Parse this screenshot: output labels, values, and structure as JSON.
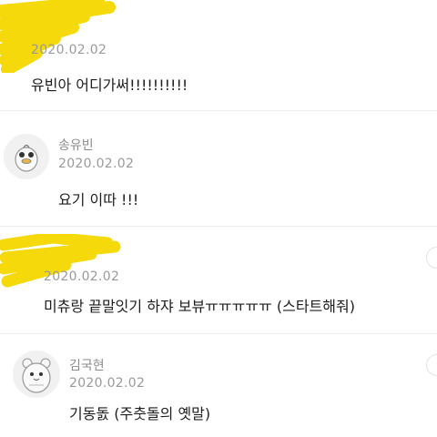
{
  "comments": [
    {
      "nickname": "",
      "date": "2020.02.02",
      "text": "유빈아 어디가써!!!!!!!!!!",
      "nickname_redacted": true
    },
    {
      "nickname": "송유빈",
      "date": "2020.02.02",
      "text": "요기 이따 !!!",
      "avatar_icon": "duck-avatar-icon"
    },
    {
      "nickname": "",
      "date": "2020.02.02",
      "text": "미츄랑 끝말잇기 하쟈 보뷰ㅠㅠㅠㅠㅠ (스타트해줘)",
      "nickname_redacted": true
    },
    {
      "nickname": "김국현",
      "date": "2020.02.02",
      "text": "기동돐 (주춧돌의 옛말)",
      "avatar_icon": "hamster-avatar-icon"
    }
  ],
  "colors": {
    "redaction": "#f5d90a",
    "date": "#9a9a9a",
    "nickname": "#8c8c8c",
    "divider": "#ebebeb"
  }
}
